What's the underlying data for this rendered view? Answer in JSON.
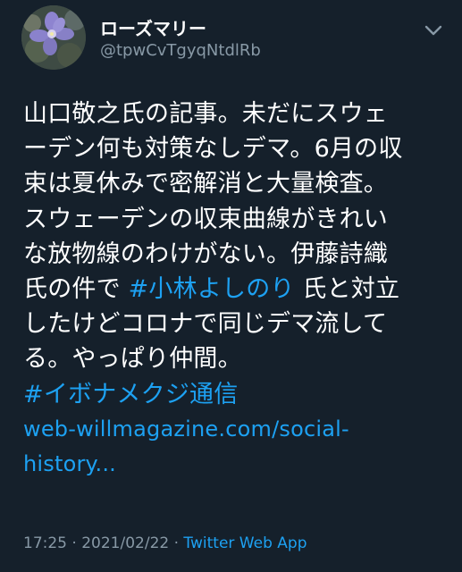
{
  "user": {
    "display_name": "ローズマリー",
    "handle": "@tpwCvTgyqNtdlRb"
  },
  "tweet": {
    "line1": "山口敬之氏の記事。未だにスウェ",
    "line2": "ーデン何も対策なしデマ。6月の収",
    "line3": "束は夏休みで密解消と大量検査。",
    "line4": "スウェーデンの収束曲線がきれい",
    "line5": "な放物線のわけがない。伊藤詩織",
    "line6_before": "氏の件で ",
    "hashtag1": "#小林よしのり",
    "line6_after": " 氏と対立",
    "line7": "したけどコロナで同じデマ流して",
    "line8": "る。やっぱり仲間。",
    "hashtag2": "#イボナメクジ通信",
    "link_part1": "web-willmagazine.com/social-",
    "link_part2": "history..."
  },
  "meta": {
    "time": "17:25",
    "separator1": " · ",
    "date": "2021/02/22",
    "separator2": " · ",
    "app": "Twitter Web App"
  },
  "icons": {
    "avatar": "avatar-flower-photo",
    "more": "chevron-down-icon"
  },
  "colors": {
    "background": "#15202b",
    "text": "#ffffff",
    "secondary": "#8899a6",
    "accent": "#1da1f2"
  }
}
